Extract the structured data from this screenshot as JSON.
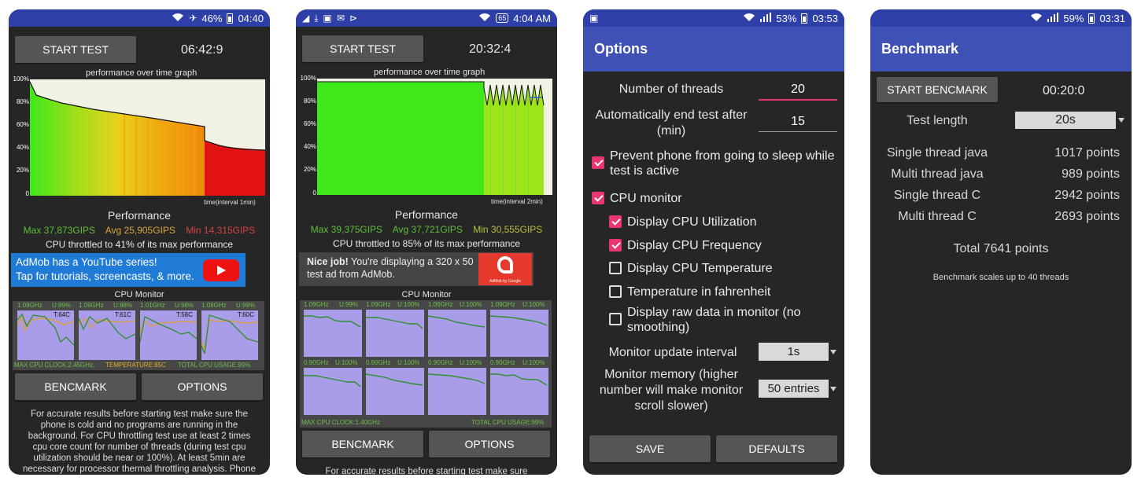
{
  "screens": [
    {
      "status": {
        "battery": "46%",
        "time": "04:40"
      },
      "start_button": "START TEST",
      "timer": "06:42:9",
      "graph_title": "performance over time graph",
      "y_ticks": [
        "100%",
        "80%",
        "60%",
        "40%",
        "20%",
        "0"
      ],
      "x_label": "time(interval 1min)",
      "performance_title": "Performance",
      "max": "Max 37,873GIPS",
      "avg": "Avg 25,905GIPS",
      "min": "Min 14,315GIPS",
      "throttle": "CPU throttled to 41% of its max performance",
      "ad_line1": "AdMob has a YouTube series!",
      "ad_line2": "Tap for tutorials, screencasts, & more.",
      "cpu_monitor_title": "CPU Monitor",
      "cores": [
        {
          "freq": "1.09GHz",
          "usage": "U:99%",
          "temp": "T:64C"
        },
        {
          "freq": "1.09GHz",
          "usage": "U:98%",
          "temp": "T:61C"
        },
        {
          "freq": "1.01GHz",
          "usage": "U:98%",
          "temp": "T:58C"
        },
        {
          "freq": "1.09GHz",
          "usage": "U:99%",
          "temp": "T:60C"
        }
      ],
      "max_clock": "MAX CPU CLOCK:2.45GHz,",
      "temperature": "TEMPERATURE:85C",
      "total_usage": "TOTAL CPU USAGE:99%",
      "benchmark_button": "BENCMARK",
      "options_button": "OPTIONS",
      "help_text": "For accurate results before starting test make sure the phone is cold and no programs are running in the background. For CPU throttling test use at least 2 times cpu core count for number of threads (during test cpu utilization should be near or 100%). At least 5min are necessary for processor thermal throttling analysis. Phone will heat up"
    },
    {
      "status": {
        "battery": "65",
        "time": "4:04 AM"
      },
      "start_button": "START TEST",
      "timer": "20:32:4",
      "graph_title": "performance over time graph",
      "y_ticks": [
        "100%",
        "80%",
        "60%",
        "40%",
        "20%",
        "0"
      ],
      "x_label": "time(interval 2min)",
      "performance_title": "Performance",
      "max": "Max 39,375GIPS",
      "avg": "Avg 37,721GIPS",
      "min": "Min 30,555GIPS",
      "throttle": "CPU throttled to 85% of its max performance",
      "ad_bold": "Nice job!",
      "ad_text": " You're displaying a 320 x 50 test ad from AdMob.",
      "ad_brand": "AdMob by Google",
      "cpu_monitor_title": "CPU Monitor",
      "cores_top": [
        {
          "freq": "1.09GHz",
          "usage": "U:99%"
        },
        {
          "freq": "1.09GHz",
          "usage": "U:100%"
        },
        {
          "freq": "1.09GHz",
          "usage": "U:100%"
        },
        {
          "freq": "1.09GHz",
          "usage": "U:100%"
        }
      ],
      "cores_bottom": [
        {
          "freq": "0.90GHz",
          "usage": "U:100%"
        },
        {
          "freq": "0.90GHz",
          "usage": "U:100%"
        },
        {
          "freq": "0.90GHz",
          "usage": "U:100%"
        },
        {
          "freq": "0.90GHz",
          "usage": "U:100%"
        }
      ],
      "max_clock": "MAX CPU CLOCK:1.40GHz",
      "total_usage": "TOTAL CPU USAGE:99%",
      "benchmark_button": "BENCMARK",
      "options_button": "OPTIONS",
      "help_text": "For accurate results before starting test make sure"
    },
    {
      "status": {
        "battery": "53%",
        "time": "03:53"
      },
      "title": "Options",
      "threads_label": "Number of threads",
      "threads_value": "20",
      "autoend_label": "Automatically end test after (min)",
      "autoend_value": "15",
      "checkboxes": [
        {
          "label": "Prevent phone from going to sleep while test is active",
          "checked": true
        },
        {
          "label": "CPU monitor",
          "checked": true
        },
        {
          "label": "Display CPU Utilization",
          "checked": true
        },
        {
          "label": "Display CPU Frequency",
          "checked": true
        },
        {
          "label": "Display CPU Temperature",
          "checked": false
        },
        {
          "label": "Temperature in fahrenheit",
          "checked": false
        },
        {
          "label": "Display raw data in monitor (no smoothing)",
          "checked": false
        }
      ],
      "interval_label": "Monitor update interval",
      "interval_value": "1s",
      "memory_label": "Monitor memory (higher number will make monitor scroll slower)",
      "memory_value": "50 entries",
      "save_button": "SAVE",
      "defaults_button": "DEFAULTS"
    },
    {
      "status": {
        "battery": "59%",
        "time": "03:31"
      },
      "title": "Benchmark",
      "start_button": "START BENCMARK",
      "timer": "00:20:0",
      "test_length_label": "Test length",
      "test_length_value": "20s",
      "results": [
        {
          "label": "Single thread java",
          "value": "1017 points"
        },
        {
          "label": "Multi thread java",
          "value": "989 points"
        },
        {
          "label": "Single thread C",
          "value": "2942 points"
        },
        {
          "label": "Multi thread C",
          "value": "2693 points"
        }
      ],
      "total": "Total 7641 points",
      "note": "Benchmark scales up to 40 threads"
    }
  ]
}
